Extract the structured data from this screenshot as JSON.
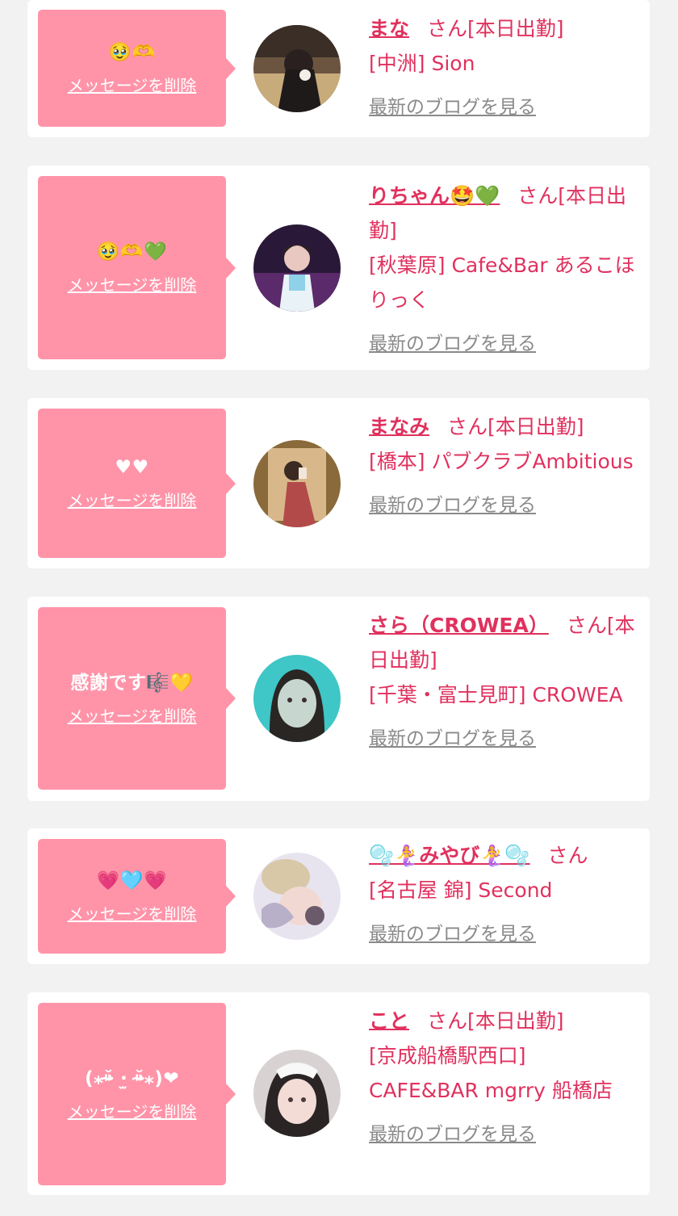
{
  "delete_label": "メッセージを削除",
  "blog_label": "最新のブログを見る",
  "san_label": "さん",
  "cards": [
    {
      "message": "🥹🫶",
      "name": "まな",
      "status": "[本日出勤]",
      "shop": "[中洲] Sion"
    },
    {
      "message": "🥹🫶💚",
      "name": "りちゃん🤩💚",
      "status": "[本日出勤]",
      "shop": "[秋葉原] Cafe&Bar あるこほりっく"
    },
    {
      "message": "♥♥",
      "name": "まなみ",
      "status": "[本日出勤]",
      "shop": "[橋本] パブクラブAmbitious"
    },
    {
      "message": "感謝です🎼💛",
      "name": "さら（CROWEA）",
      "status": "[本日出勤]",
      "shop": "[千葉・富士見町] CROWEA"
    },
    {
      "message": "💗🩵💗",
      "name": "🫧🧜‍♀️みやび🧜‍♀️🫧",
      "status": "",
      "shop": "[名古屋 錦] Second"
    },
    {
      "message": "(⁎⁍̴̆ ·̫ ⁍̴̆⁎)❤",
      "name": "こと",
      "status": "[本日出勤]",
      "shop": "[京成船橋駅西口] CAFE&BAR mgrry 船橋店"
    }
  ]
}
